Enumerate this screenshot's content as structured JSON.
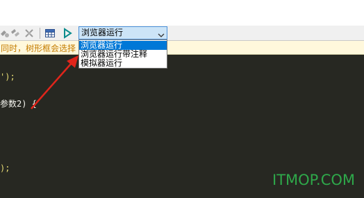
{
  "toolbar": {
    "icons": [
      "tool-icon-1",
      "tool-icon-2",
      "tool-icon-3",
      "grid-icon",
      "run-icon"
    ],
    "run_mode_select": {
      "selected": "浏览器运行"
    }
  },
  "dropdown": {
    "options": [
      "浏览器运行",
      "浏览器运行带注释",
      "模拟器运行"
    ],
    "highlighted_index": 0
  },
  "editor": {
    "hint": "同时，树形框会选择",
    "lines": [
      {
        "text": "');"
      },
      {
        "text": "参数2) {"
      },
      {
        "text": ");"
      }
    ]
  },
  "watermark": "ITMOP.COM",
  "colors": {
    "editor_bg": "#272822",
    "hint_bg": "#fff8dc",
    "selection": "#0078d7",
    "arrow": "#e0251b",
    "watermark": "#2ea84a"
  }
}
